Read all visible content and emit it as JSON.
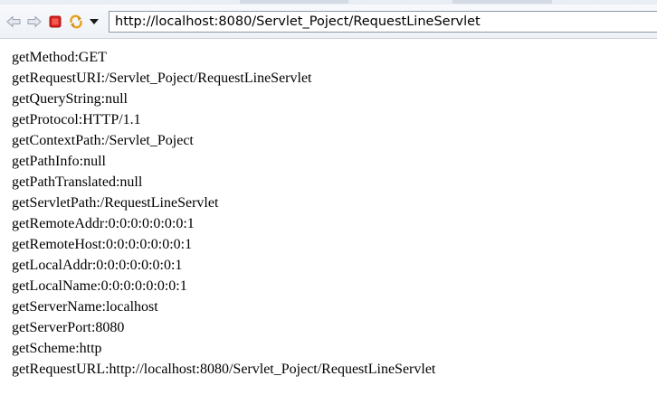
{
  "browser": {
    "toolbar": {
      "back_icon": "arrow-left-icon",
      "forward_icon": "arrow-right-icon",
      "stop_icon": "stop-icon",
      "refresh_icon": "refresh-icon",
      "dropdown_icon": "chevron-down-icon",
      "stop_color": "#d9201c",
      "refresh_color": "#e8a21a"
    },
    "address_bar": {
      "url": "http://localhost:8080/Servlet_Poject/RequestLineServlet"
    }
  },
  "page": {
    "lines": [
      "getMethod:GET",
      "getRequestURI:/Servlet_Poject/RequestLineServlet",
      "getQueryString:null",
      "getProtocol:HTTP/1.1",
      "getContextPath:/Servlet_Poject",
      "getPathInfo:null",
      "getPathTranslated:null",
      "getServletPath:/RequestLineServlet",
      "getRemoteAddr:0:0:0:0:0:0:0:1",
      "getRemoteHost:0:0:0:0:0:0:0:1",
      "getLocalAddr:0:0:0:0:0:0:0:1",
      "getLocalName:0:0:0:0:0:0:0:1",
      "getServerName:localhost",
      "getServerPort:8080",
      "getScheme:http",
      "getRequestURL:http://localhost:8080/Servlet_Poject/RequestLineServlet"
    ]
  }
}
